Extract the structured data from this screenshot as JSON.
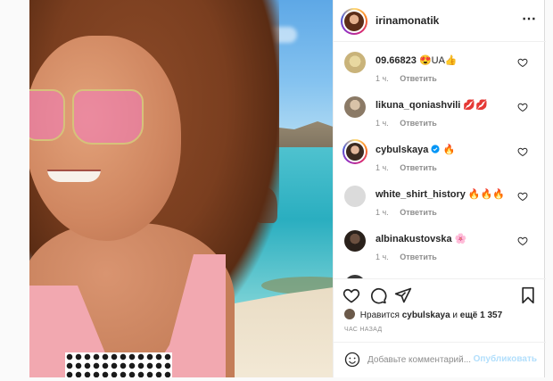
{
  "post": {
    "author": "irinamonatik",
    "more_icon": "⋯",
    "comments": [
      {
        "user": "09.66823",
        "text": "😍UA👍",
        "time": "1 ч.",
        "reply": "Ответить",
        "avatar_color": "#c9b37a"
      },
      {
        "user": "likuna_qoniashvili",
        "text": "💋💋",
        "time": "1 ч.",
        "reply": "Ответить",
        "avatar_color": "#b8a89a"
      },
      {
        "user": "cybulskaya",
        "text": "🔥",
        "time": "1 ч.",
        "reply": "Ответить",
        "avatar_color": "#c79a7e",
        "verified": true,
        "story_ring": true
      },
      {
        "user": "white_shirt_history",
        "text": "🔥🔥🔥",
        "time": "1 ч.",
        "reply": "Ответить",
        "avatar_color": "#dbdbdb"
      },
      {
        "user": "albinakustovska",
        "text": "🌸",
        "time": "1 ч.",
        "reply": "Ответить",
        "avatar_color": "#3a2e26"
      }
    ],
    "likes": {
      "prefix": "Нравится",
      "user": "cybulskaya",
      "middle": "и",
      "count_text": "ещё 1 357"
    },
    "time_ago": "ЧАС НАЗАД",
    "add_comment": {
      "placeholder": "Добавьте комментарий...",
      "publish_label": "Опубликовать"
    }
  },
  "colors": {
    "verified": "#0095f6",
    "publish_disabled": "#b2dffc",
    "meta": "#8e8e8e"
  }
}
